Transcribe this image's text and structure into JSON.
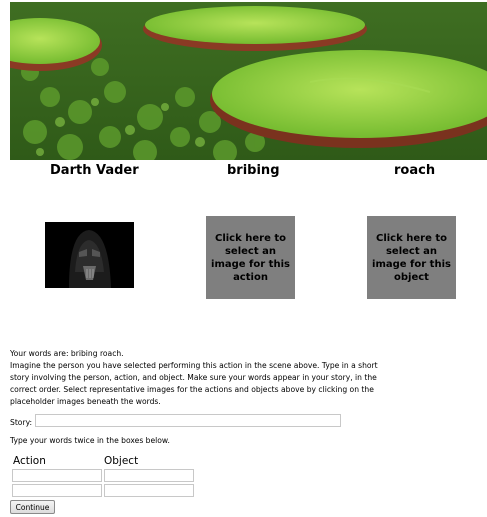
{
  "scene": {
    "alt": "lily pads scene"
  },
  "labels": {
    "person": "Darth Vader",
    "action": "bribing",
    "object": "roach"
  },
  "placeholders": {
    "action": "Click here to select an image for this action",
    "object": "Click here to select an image for this object"
  },
  "instructions": {
    "line1": "Your words are: bribing roach.",
    "line2": "Imagine the person you have selected performing this action in the scene above. Type in a short story involving the person, action, and object. Make sure your words appear in your story, in the correct order. Select representative images for the actions and objects above by clicking on the placeholder images beneath the words."
  },
  "story": {
    "label": "Story:",
    "value": ""
  },
  "twice_text": "Type your words twice in the boxes below.",
  "columns": {
    "action": "Action",
    "object": "Object"
  },
  "continue_label": "Continue",
  "colors": {
    "placeholder_bg": "#7f7f7f",
    "lily_green": "#7cc43a",
    "lily_rim": "#8a3a24"
  }
}
